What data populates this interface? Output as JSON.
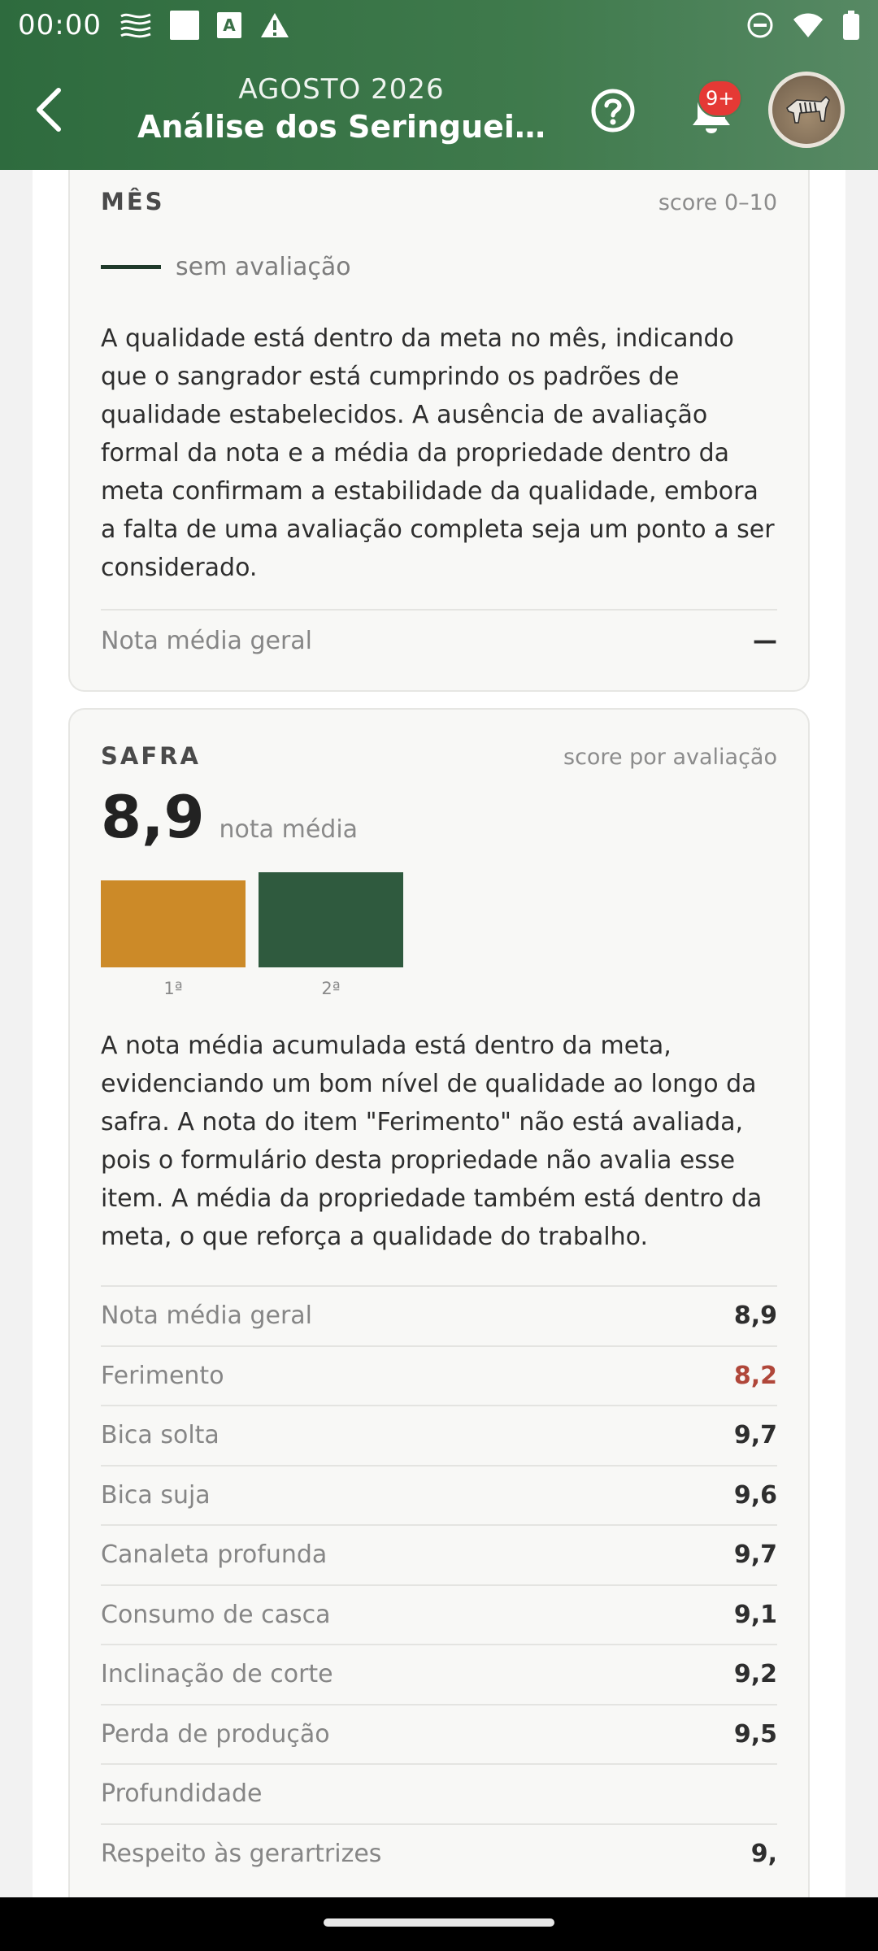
{
  "status_bar": {
    "time": "00:00",
    "letter_icon": "A"
  },
  "header": {
    "subtitle": "AGOSTO 2026",
    "title": "Análise dos Seringuei…",
    "notification_badge": "9+"
  },
  "month_card": {
    "label": "MÊS",
    "meta": "score 0–10",
    "legend": "sem avaliação",
    "paragraph": "A qualidade está dentro da meta no mês, indicando que o sangrador está cumprindo os padrões de qualidade estabelecidos. A ausência de avaliação formal da nota e a média da propriedade dentro da meta confirmam a estabilidade da qualidade, embora a falta de uma avaliação completa seja um ponto a ser considerado.",
    "overall_label": "Nota média geral",
    "overall_value": "—"
  },
  "harvest_card": {
    "label": "SAFRA",
    "meta": "score por avaliação",
    "score": "8,9",
    "score_caption": "nota média",
    "paragraph": "A nota média acumulada está dentro da meta, evidenciando um bom nível de qualidade ao longo da safra. A nota do item \"Ferimento\" não está avaliada, pois o formulário desta propriedade não avalia esse item. A média da propriedade também está dentro da meta, o que reforça a qualidade do trabalho.",
    "items": [
      {
        "label": "Nota média geral",
        "value": "8,9"
      },
      {
        "label": "Ferimento",
        "value": "8,2"
      },
      {
        "label": "Bica solta",
        "value": "9,7"
      },
      {
        "label": "Bica suja",
        "value": "9,6"
      },
      {
        "label": "Canaleta profunda",
        "value": "9,7"
      },
      {
        "label": "Consumo de casca",
        "value": "9,1"
      },
      {
        "label": "Inclinação de corte",
        "value": "9,2"
      },
      {
        "label": "Perda de produção",
        "value": "9,5"
      },
      {
        "label": "Profundidade",
        "value": ""
      },
      {
        "label": "Respeito às gerartrizes",
        "value": "9,"
      }
    ]
  },
  "chart_data": {
    "type": "bar",
    "categories": [
      "1ª",
      "2ª"
    ],
    "values": [
      8.2,
      9.0
    ],
    "colors": [
      "#cc8a28",
      "#2f5a3e"
    ],
    "ylim": [
      0,
      10
    ]
  },
  "colors": {
    "header_green": "#2e6b3e",
    "accent_dark_green": "#2f5a3e",
    "accent_amber": "#cc8a28",
    "low_score_red": "#b0473a",
    "badge_red": "#e53935"
  },
  "icons": {
    "back": "chevron-left-icon",
    "help": "help-circle-icon",
    "bell": "bell-icon",
    "fab": "pdf-icon"
  }
}
